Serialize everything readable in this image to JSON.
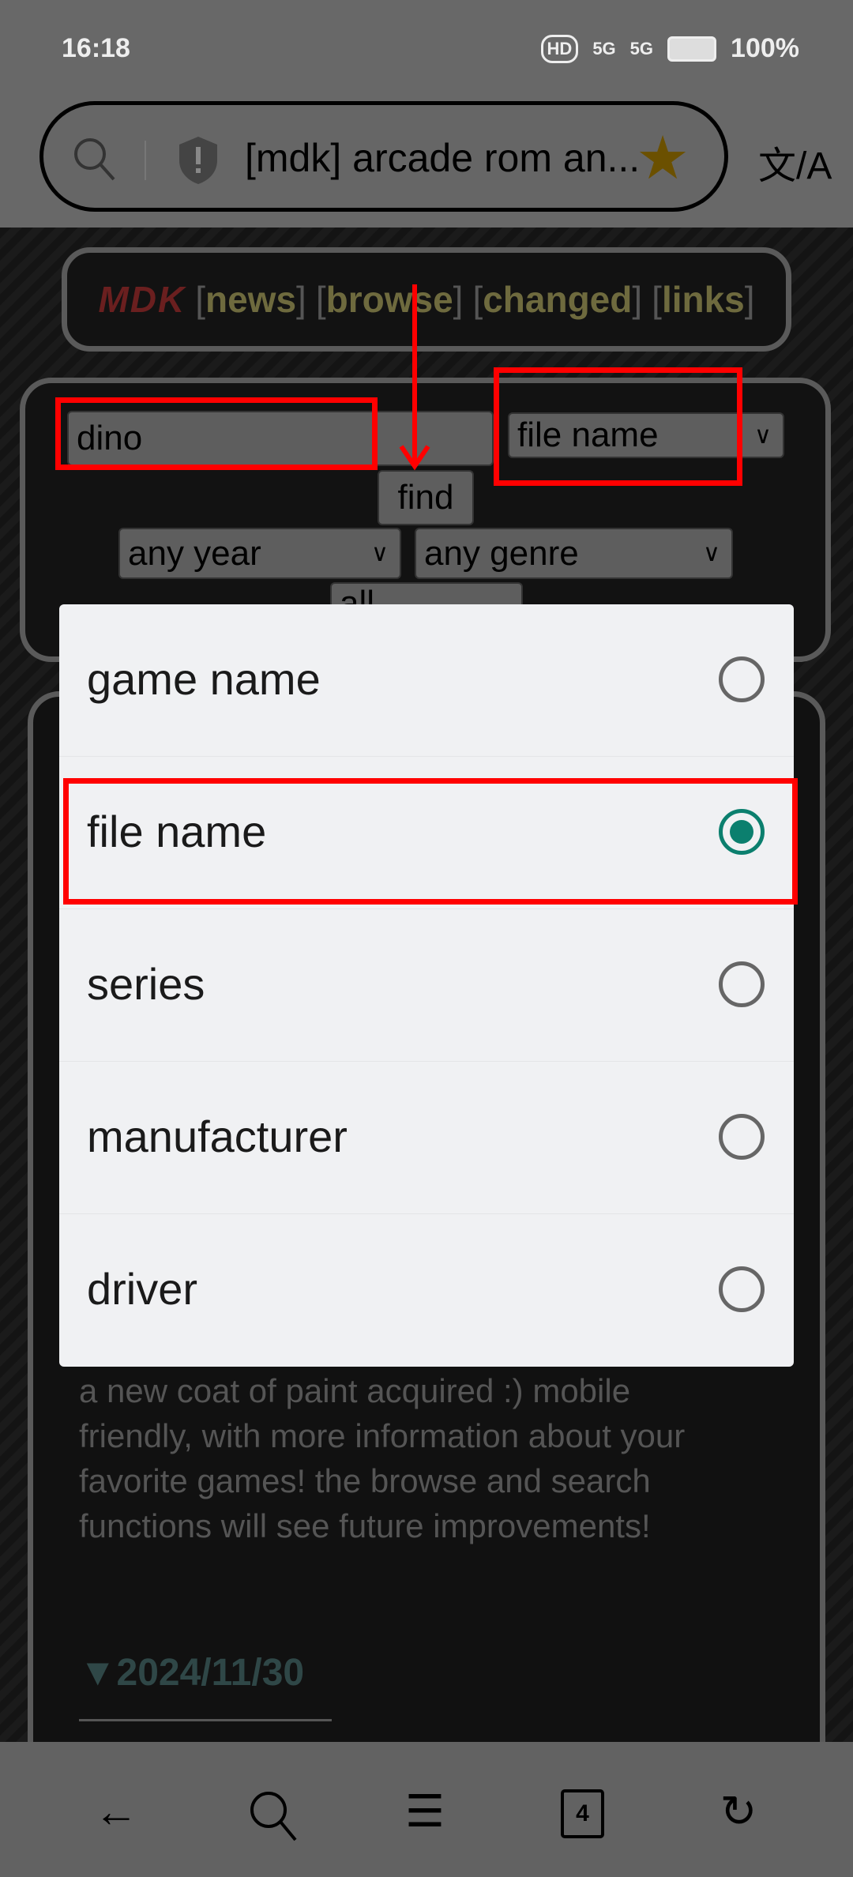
{
  "status_bar": {
    "time": "16:18",
    "battery": "100%",
    "icons": [
      "hd-icon",
      "signal-5g-icon",
      "signal-5g-icon",
      "battery-icon"
    ]
  },
  "browser": {
    "page_title": "[mdk] arcade rom an...",
    "icons": [
      "search-icon",
      "shield-icon",
      "star-icon",
      "translate-icon"
    ]
  },
  "site_nav": {
    "logo": "MDK",
    "links": [
      "news",
      "browse",
      "changed",
      "links"
    ]
  },
  "search_form": {
    "query": "dino",
    "search_by": "file name",
    "find_label": "find",
    "year": "any year",
    "genre": "any genre",
    "filter": "all"
  },
  "dialog": {
    "options": [
      {
        "label": "game name",
        "selected": false
      },
      {
        "label": "file name",
        "selected": true
      },
      {
        "label": "series",
        "selected": false
      },
      {
        "label": "manufacturer",
        "selected": false
      },
      {
        "label": "driver",
        "selected": false
      }
    ]
  },
  "news": {
    "text": "a new coat of paint acquired :) mobile friendly, with more information about your favorite games! the browse and search functions will see future improvements!",
    "date": "2024/11/30",
    "date_marker": "▼"
  },
  "bottom_nav": {
    "tab_count": "4",
    "icons": [
      "back-icon",
      "search-icon",
      "menu-icon",
      "tabs-icon",
      "reload-icon"
    ]
  },
  "colors": {
    "accent": "#0b7f6e",
    "annotation": "#ff0000",
    "link": "#6e6a3e"
  }
}
